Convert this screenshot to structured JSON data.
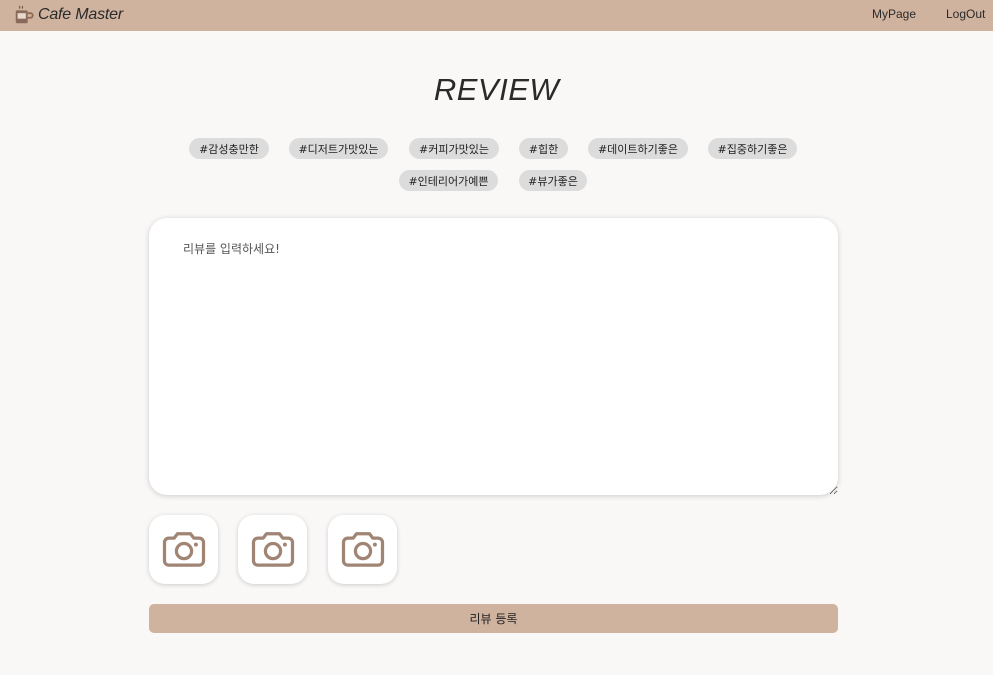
{
  "navbar": {
    "brand": "Cafe Master",
    "brand_icon": "coffee-cup-icon",
    "links": [
      "MyPage",
      "LogOut"
    ]
  },
  "page_title": "REVIEW",
  "tags": [
    "#감성충만한",
    "#디저트가맛있는",
    "#커피가맛있는",
    "#힙한",
    "#데이트하기좋은",
    "#집중하기좋은",
    "#인테리어가예쁜",
    "#뷰가좋은"
  ],
  "review": {
    "placeholder": "리뷰를 입력하세요!",
    "value": ""
  },
  "photos": {
    "icon": "camera-icon",
    "count": 3
  },
  "submit_label": "리뷰 등록",
  "colors": {
    "accent": "#d0b39f",
    "background": "#faf8f7",
    "tag_bg": "#dcdcdc",
    "icon": "#a08474"
  }
}
